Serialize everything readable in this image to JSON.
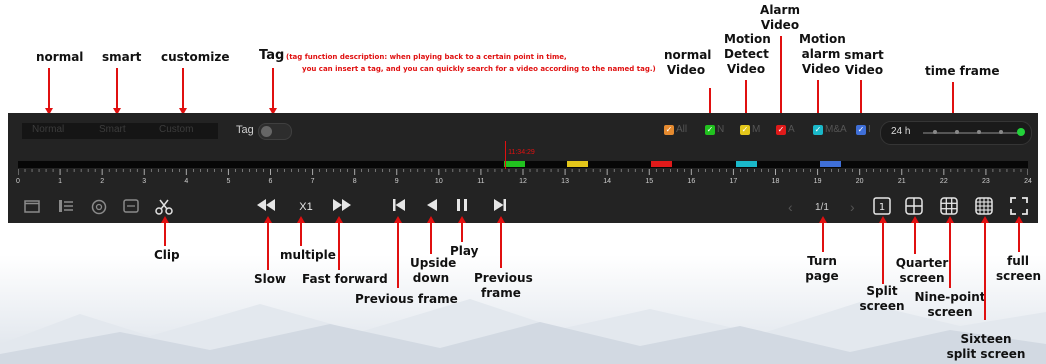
{
  "top_annotations": {
    "normal": "normal",
    "smart": "smart",
    "customize": "customize",
    "tag_title": "Tag",
    "tag_desc_line1": "(tag function description: when playing back to a certain point in time,",
    "tag_desc_line2": "you can insert a tag, and you can quickly search for a video according to the named tag.)",
    "normal_video": [
      "normal",
      "Video"
    ],
    "motion_detect_video": [
      "Motion",
      "Detect",
      "Video"
    ],
    "alarm_video": [
      "Alarm",
      "Video"
    ],
    "motion_alarm_video": [
      "Motion",
      "alarm",
      "Video"
    ],
    "smart_video": [
      "smart",
      "Video"
    ],
    "time_frame": "time frame"
  },
  "player": {
    "modes": [
      "Normal",
      "Smart",
      "Custom"
    ],
    "tag_label": "Tag",
    "filters": [
      {
        "label": "All",
        "color": "#e58a2f"
      },
      {
        "label": "N",
        "color": "#21c21f"
      },
      {
        "label": "M",
        "color": "#e3c61a"
      },
      {
        "label": "A",
        "color": "#e01a1a"
      },
      {
        "label": "M&A",
        "color": "#1ab8c9"
      },
      {
        "label": "I",
        "color": "#3f6fd8"
      }
    ],
    "time_frame_label": "24 h",
    "time_frame_level": 1.0,
    "cursor_time": "11:34:29",
    "ticks": [
      "0",
      "1",
      "2",
      "3",
      "4",
      "5",
      "6",
      "7",
      "8",
      "9",
      "10",
      "11",
      "12",
      "13",
      "14",
      "15",
      "16",
      "17",
      "18",
      "19",
      "20",
      "21",
      "22",
      "23",
      "24"
    ],
    "segments": [
      {
        "start": 11.55,
        "end": 12.05,
        "color": "#21c21f"
      },
      {
        "start": 13.05,
        "end": 13.55,
        "color": "#e3c61a"
      },
      {
        "start": 15.05,
        "end": 15.55,
        "color": "#e01a1a"
      },
      {
        "start": 17.05,
        "end": 17.55,
        "color": "#1ab8c9"
      },
      {
        "start": 19.05,
        "end": 19.55,
        "color": "#3f6fd8"
      }
    ],
    "speed": "X1",
    "page": "1/1"
  },
  "bottom_annotations": {
    "clip": "Clip",
    "slow": "Slow",
    "multiple": "multiple",
    "fast_forward": "Fast forward",
    "previous_frame": "Previous frame",
    "upside_down": [
      "Upside",
      "down"
    ],
    "play": "Play",
    "next_frame": [
      "Previous",
      "frame"
    ],
    "turn_page": [
      "Turn",
      "page"
    ],
    "split_screen": [
      "Split",
      "screen"
    ],
    "quarter_screen": [
      "Quarter",
      "screen"
    ],
    "nine_point_screen": [
      "Nine-point",
      "screen"
    ],
    "sixteen_split_screen": [
      "Sixteen",
      "split screen"
    ],
    "full_screen": [
      "full",
      "screen"
    ]
  }
}
